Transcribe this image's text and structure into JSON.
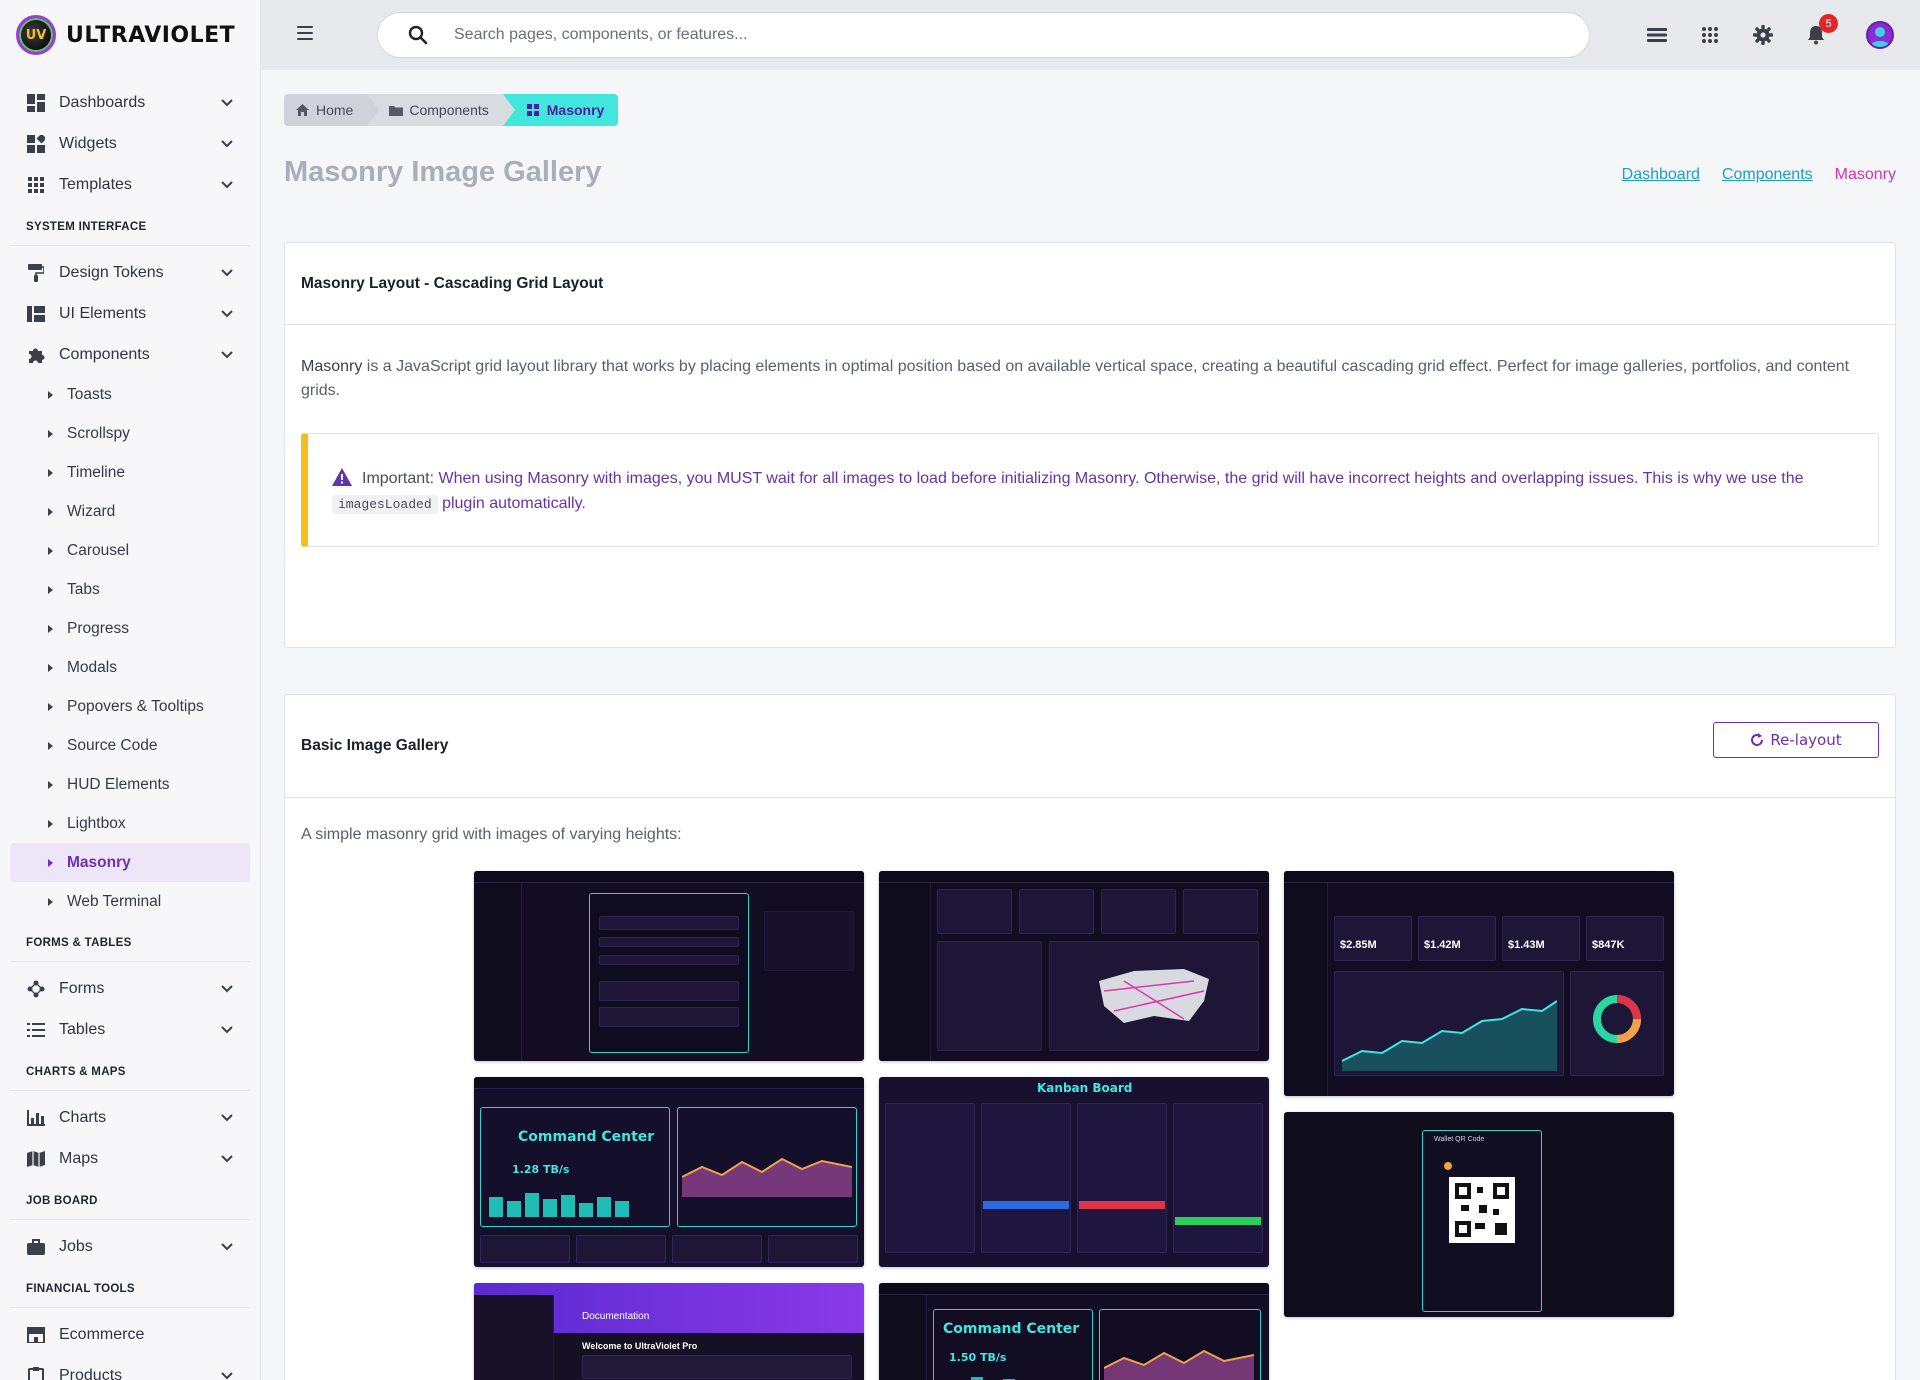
{
  "brand": {
    "name": "ULTRAVIOLET",
    "logo_text": "UV"
  },
  "search": {
    "placeholder": "Search pages, components, or features..."
  },
  "notifications": {
    "count": "5"
  },
  "sidebar": {
    "top_items": [
      {
        "label": "Dashboards",
        "icon": "dashboard-icon"
      },
      {
        "label": "Widgets",
        "icon": "widgets-icon"
      },
      {
        "label": "Templates",
        "icon": "grid-icon"
      }
    ],
    "sections": [
      {
        "title": "SYSTEM INTERFACE"
      },
      {
        "title": "FORMS & TABLES"
      },
      {
        "title": "CHARTS & MAPS"
      },
      {
        "title": "JOB BOARD"
      },
      {
        "title": "FINANCIAL TOOLS"
      }
    ],
    "system_items": [
      {
        "label": "Design Tokens"
      },
      {
        "label": "UI Elements"
      },
      {
        "label": "Components"
      }
    ],
    "component_subitems": [
      "Toasts",
      "Scrollspy",
      "Timeline",
      "Wizard",
      "Carousel",
      "Tabs",
      "Progress",
      "Modals",
      "Popovers & Tooltips",
      "Source Code",
      "HUD Elements",
      "Lightbox",
      "Masonry",
      "Web Terminal"
    ],
    "forms_items": [
      {
        "label": "Forms"
      },
      {
        "label": "Tables"
      }
    ],
    "charts_items": [
      {
        "label": "Charts"
      },
      {
        "label": "Maps"
      }
    ],
    "job_items": [
      {
        "label": "Jobs"
      }
    ],
    "financial_items": [
      {
        "label": "Ecommerce"
      },
      {
        "label": "Products"
      }
    ]
  },
  "breadcrumb": {
    "home": "Home",
    "components": "Components",
    "current": "Masonry"
  },
  "page": {
    "title": "Masonry Image Gallery",
    "links": {
      "dashboard": "Dashboard",
      "components": "Components",
      "current": "Masonry"
    }
  },
  "intro_card": {
    "title": "Masonry Layout - Cascading Grid Layout",
    "lead_strong": "Masonry",
    "lead_rest": " is a JavaScript grid layout library that works by placing elements in optimal position based on available vertical space, creating a beautiful cascading grid effect. Perfect for image galleries, portfolios, and content grids.",
    "alert_label": "Important:",
    "alert_text_1": " When using Masonry with images, you MUST wait for all images to load before initializing Masonry. Otherwise, the grid will have incorrect heights and overlapping issues. This is why we use the ",
    "alert_code": "imagesLoaded",
    "alert_text_2": " plugin automatically."
  },
  "gallery_card": {
    "title": "Basic Image Gallery",
    "relayout_label": "Re-layout",
    "description": "A simple masonry grid with images of varying heights:"
  },
  "thumbnails": {
    "command_center": "Command Center",
    "kanban": "Kanban Board",
    "docs_title": "Welcome to UltraViolet Pro",
    "docs_header": "Documentation",
    "wallet": "Wallet QR Code",
    "stat_1": "$2.85M",
    "stat_2": "$1.42M",
    "stat_3": "$1.43M",
    "stat_4": "$847K",
    "tb_1": "1.28 TB/s",
    "tb_2": "1.50 TB/s"
  }
}
